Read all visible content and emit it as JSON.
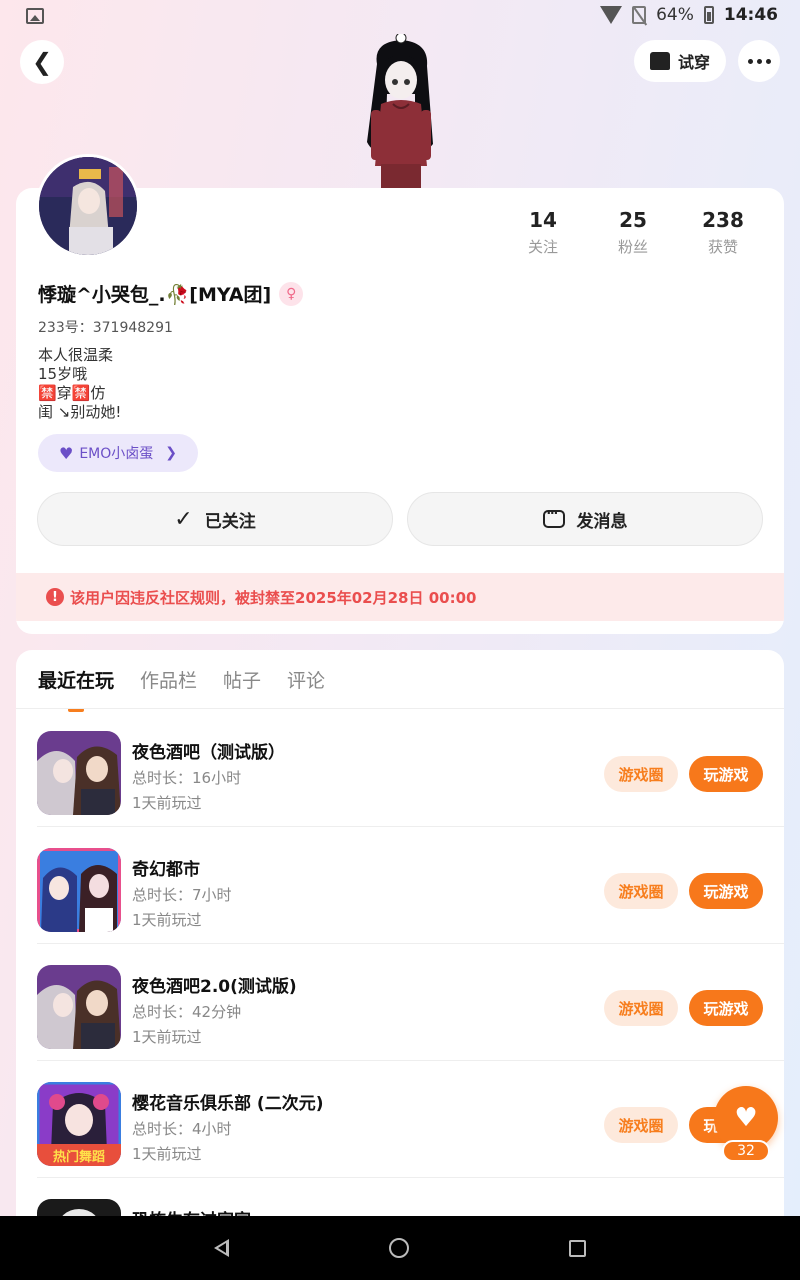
{
  "status_bar": {
    "battery": "64%",
    "time": "14:46"
  },
  "header": {
    "try_on_label": "试穿"
  },
  "profile": {
    "stats": [
      {
        "num": "14",
        "label": "关注"
      },
      {
        "num": "25",
        "label": "粉丝"
      },
      {
        "num": "238",
        "label": "获赞"
      }
    ],
    "nickname": "悸璇^小哭包_.🥀[MYA团]",
    "gender_symbol": "♀",
    "uid_line": "233号：371948291",
    "bio_lines": [
      "本人很温柔",
      "15岁哦",
      "🈲穿🈲仿",
      "闺 ↘别动她!"
    ],
    "tag_label": "EMO小卤蛋",
    "follow_label": "已关注",
    "message_label": "发消息",
    "ban_notice": "该用户因违反社区规则，被封禁至2025年02月28日 00:00"
  },
  "tabs": [
    "最近在玩",
    "作品栏",
    "帖子",
    "评论"
  ],
  "games": [
    {
      "title": "夜色酒吧（测试版）",
      "duration": "总时长：16小时",
      "last_played": "1天前玩过",
      "circle_label": "游戏圈",
      "play_label": "玩游戏"
    },
    {
      "title": "奇幻都市",
      "duration": "总时长：7小时",
      "last_played": "1天前玩过",
      "circle_label": "游戏圈",
      "play_label": "玩游戏"
    },
    {
      "title": "夜色酒吧2.0(测试版)",
      "duration": "总时长：42分钟",
      "last_played": "1天前玩过",
      "circle_label": "游戏圈",
      "play_label": "玩游戏"
    },
    {
      "title": "樱花音乐俱乐部 (二次元)",
      "duration": "总时长：4小时",
      "last_played": "1天前玩过",
      "circle_label": "游戏圈",
      "play_label": "玩游戏",
      "icon_caption": "热门舞蹈"
    },
    {
      "title": "恐怖生存过家家"
    }
  ],
  "like": {
    "count": "32"
  }
}
